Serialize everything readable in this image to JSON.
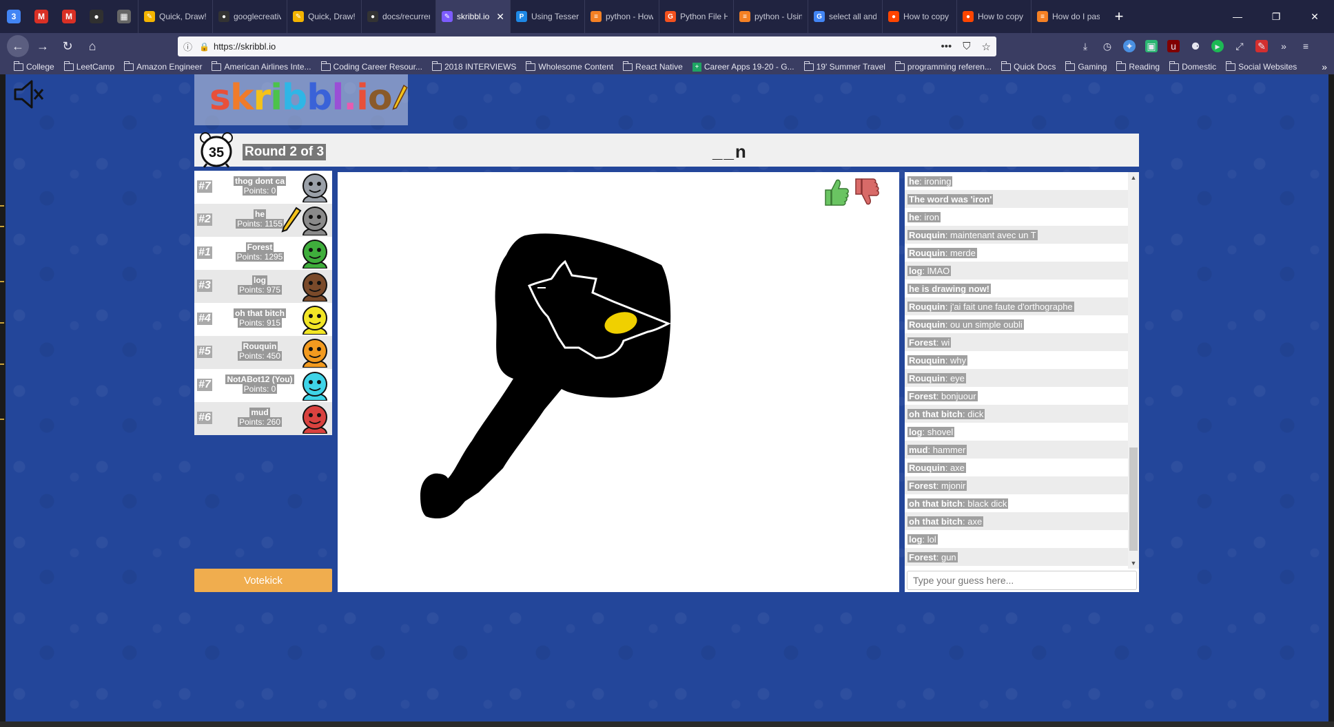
{
  "browser": {
    "pinned_tabs": [
      {
        "icon": "calendar-icon",
        "glyph": "3",
        "color": "#4285f4"
      },
      {
        "icon": "gmail-icon",
        "glyph": "M",
        "color": "#d93025"
      },
      {
        "icon": "gmail-icon",
        "glyph": "M",
        "color": "#d93025"
      },
      {
        "icon": "chat-icon",
        "glyph": "●",
        "color": "#303030"
      },
      {
        "icon": "qr-icon",
        "glyph": "▦",
        "color": "#666666"
      }
    ],
    "tabs": [
      {
        "label": "Quick, Draw!",
        "icon": "quickdraw-icon",
        "glyph": "✎",
        "color": "#f4b400",
        "active": false
      },
      {
        "label": "googlecreative",
        "icon": "github-icon",
        "glyph": "●",
        "color": "#333333",
        "active": false
      },
      {
        "label": "Quick, Draw!",
        "icon": "quickdraw-icon",
        "glyph": "✎",
        "color": "#f4b400",
        "active": false
      },
      {
        "label": "docs/recurrent",
        "icon": "github-icon",
        "glyph": "●",
        "color": "#333333",
        "active": false
      },
      {
        "label": "skribbl.io",
        "icon": "skribbl-icon",
        "glyph": "✎",
        "color": "#7c5cff",
        "active": true
      },
      {
        "label": "Using Tesseract",
        "icon": "p-icon",
        "glyph": "P",
        "color": "#1e88e5",
        "active": false
      },
      {
        "label": "python - How",
        "icon": "stackoverflow-icon",
        "glyph": "≡",
        "color": "#f48024",
        "active": false
      },
      {
        "label": "Python File Ha",
        "icon": "orange-icon",
        "glyph": "G",
        "color": "#f4511e",
        "active": false
      },
      {
        "label": "python - Using",
        "icon": "stackoverflow-icon",
        "glyph": "≡",
        "color": "#f48024",
        "active": false
      },
      {
        "label": "select all and",
        "icon": "google-icon",
        "glyph": "G",
        "color": "#4285f4",
        "active": false
      },
      {
        "label": "How to copy",
        "icon": "reddit-icon",
        "glyph": "●",
        "color": "#ff4500",
        "active": false
      },
      {
        "label": "How to copy",
        "icon": "reddit-icon",
        "glyph": "●",
        "color": "#ff4500",
        "active": false
      },
      {
        "label": "How do I paste",
        "icon": "stackoverflow-icon",
        "glyph": "≡",
        "color": "#f48024",
        "active": false
      }
    ],
    "url": "https://skribbl.io",
    "bookmarks": [
      {
        "label": "College",
        "type": "folder"
      },
      {
        "label": "LeetCamp",
        "type": "folder"
      },
      {
        "label": "Amazon Engineer",
        "type": "folder"
      },
      {
        "label": "American Airlines Inte...",
        "type": "folder"
      },
      {
        "label": "Coding Career Resour...",
        "type": "folder"
      },
      {
        "label": "2018 INTERVIEWS",
        "type": "folder"
      },
      {
        "label": "Wholesome Content",
        "type": "folder"
      },
      {
        "label": "React Native",
        "type": "folder"
      },
      {
        "label": "Career Apps 19-20 - G...",
        "type": "sheet"
      },
      {
        "label": "19' Summer Travel",
        "type": "folder"
      },
      {
        "label": "programming referen...",
        "type": "folder"
      },
      {
        "label": "Quick Docs",
        "type": "folder"
      },
      {
        "label": "Gaming",
        "type": "folder"
      },
      {
        "label": "Reading",
        "type": "folder"
      },
      {
        "label": "Domestic",
        "type": "folder"
      },
      {
        "label": "Social Websites",
        "type": "folder"
      }
    ]
  },
  "game": {
    "logo_text": {
      "parts": [
        {
          "t": "s",
          "c": "#e8503a"
        },
        {
          "t": "k",
          "c": "#f07b2a"
        },
        {
          "t": "r",
          "c": "#f4c21a"
        },
        {
          "t": "i",
          "c": "#4cc34a"
        },
        {
          "t": "b",
          "c": "#2fb6e6"
        },
        {
          "t": "b",
          "c": "#3a62d8"
        },
        {
          "t": "l",
          "c": "#9a4fd6"
        },
        {
          "t": ".",
          "c": "#e85bb0"
        },
        {
          "t": "i",
          "c": "#e8503a"
        },
        {
          "t": "o",
          "c": "#8a5a2a"
        }
      ]
    },
    "timer": "35",
    "round": "Round 2 of 3",
    "word_hint": "__n",
    "players": [
      {
        "rank": "#7",
        "name": "thog dont ca",
        "score": "Points: 0",
        "avatar_color": "#9aa0a8",
        "drawing": false
      },
      {
        "rank": "#2",
        "name": "he",
        "score": "Points: 1155",
        "avatar_color": "#8a8a8a",
        "drawing": true
      },
      {
        "rank": "#1",
        "name": "Forest",
        "score": "Points: 1295",
        "avatar_color": "#3fae3c",
        "drawing": false
      },
      {
        "rank": "#3",
        "name": "log",
        "score": "Points: 975",
        "avatar_color": "#7a4a2a",
        "drawing": false
      },
      {
        "rank": "#4",
        "name": "oh that bitch",
        "score": "Points: 915",
        "avatar_color": "#f2e626",
        "drawing": false
      },
      {
        "rank": "#5",
        "name": "Rouquin",
        "score": "Points: 450",
        "avatar_color": "#f29a1f",
        "drawing": false
      },
      {
        "rank": "#7",
        "name": "NotABot12 (You)",
        "score": "Points: 0",
        "avatar_color": "#3fd4e8",
        "drawing": false
      },
      {
        "rank": "#6",
        "name": "mud",
        "score": "Points: 260",
        "avatar_color": "#d9423f",
        "drawing": false
      }
    ],
    "votekick_label": "Votekick",
    "chat": [
      {
        "who": "he",
        "text": "ironing"
      },
      {
        "who": "",
        "text": "The word was 'iron'",
        "system": true
      },
      {
        "who": "he",
        "text": "iron"
      },
      {
        "who": "Rouquin",
        "text": "maintenant avec un T"
      },
      {
        "who": "Rouquin",
        "text": "merde"
      },
      {
        "who": "log",
        "text": "lMAO"
      },
      {
        "who": "",
        "text": "he is drawing now!",
        "system": true
      },
      {
        "who": "Rouquin",
        "text": "j'ai fait une faute d'orthographe"
      },
      {
        "who": "Rouquin",
        "text": "ou un simple oubli"
      },
      {
        "who": "Forest",
        "text": "wi"
      },
      {
        "who": "Rouquin",
        "text": "why"
      },
      {
        "who": "Rouquin",
        "text": "eye"
      },
      {
        "who": "Forest",
        "text": "bonjuour"
      },
      {
        "who": "oh that bitch",
        "text": "dick"
      },
      {
        "who": "log",
        "text": "shovel"
      },
      {
        "who": "mud",
        "text": "hammer"
      },
      {
        "who": "Rouquin",
        "text": "axe"
      },
      {
        "who": "Forest",
        "text": "mjonir"
      },
      {
        "who": "oh that bitch",
        "text": "black dick"
      },
      {
        "who": "oh that bitch",
        "text": "axe"
      },
      {
        "who": "log",
        "text": "lol"
      },
      {
        "who": "Forest",
        "text": "gun"
      }
    ],
    "guess_placeholder": "Type your guess here..."
  }
}
